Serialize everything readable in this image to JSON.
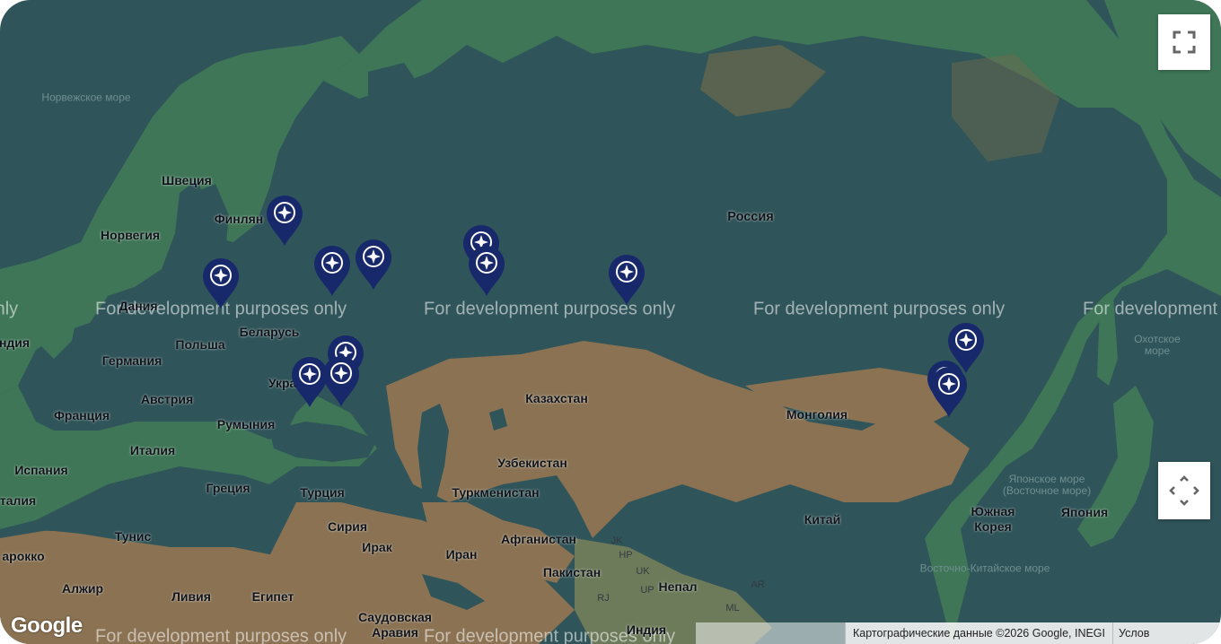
{
  "map": {
    "watermark_text": "For development purposes only",
    "google_logo": "Google",
    "attribution": "Картографические данные ©2026 Google, INEGI",
    "terms_link": "Услов",
    "colors": {
      "water": "#2f5459",
      "forest": "#3f7657",
      "desert": "#8a7253",
      "marker": "#17286b"
    }
  },
  "labels": {
    "norwegian_sea": "Норвежское море",
    "sweden": "Швеция",
    "finland": "Финлян",
    "norway": "Норвегия",
    "russia": "Россия",
    "denmark": "Дания",
    "poland": "Польша",
    "belarus": "Беларусь",
    "germany": "Германия",
    "austria": "Австрия",
    "france": "Франция",
    "ukraine": "Украина",
    "romania": "Румыния",
    "italy": "Италия",
    "spain": "Испания",
    "greece": "Греция",
    "turkey": "Турция",
    "kazakhstan": "Казахстан",
    "mongolia": "Монголия",
    "uzbekistan": "Узбекистан",
    "turkmenistan": "Туркменистан",
    "china": "Китай",
    "syria": "Сирия",
    "iraq": "Ирак",
    "iran": "Иран",
    "afghanistan": "Афганистан",
    "pakistan": "Пакистан",
    "nepal": "Непал",
    "india": "Индия",
    "saudi": "Саудовская Аравия",
    "egypt": "Египет",
    "libya": "Ливия",
    "algeria": "Алжир",
    "tunisia": "Тунис",
    "morocco": "арокко",
    "italy_edge": "талия",
    "ireland_edge": "ндия",
    "okhotsk_sea": "Охотское море",
    "japan_sea": "Японское море (Восточное море)",
    "japan": "Япония",
    "south_korea": "Южная Корея",
    "east_china_sea": "Восточно-Китайское море",
    "jk": "JK",
    "hp": "HP",
    "uk": "UK",
    "rj": "RJ",
    "up": "UP",
    "ar": "AR",
    "ml": "ML"
  },
  "markers": [
    {
      "name": "marker-saint-petersburg",
      "lon": 30.3,
      "lat": 59.9
    },
    {
      "name": "marker-kaliningrad",
      "lon": 20.5,
      "lat": 54.7
    },
    {
      "name": "marker-moscow",
      "lon": 37.6,
      "lat": 55.8
    },
    {
      "name": "marker-nizhny-novgorod",
      "lon": 44.0,
      "lat": 56.3
    },
    {
      "name": "marker-yekaterinburg-north",
      "lon": 60.6,
      "lat": 57.5
    },
    {
      "name": "marker-yekaterinburg",
      "lon": 61.4,
      "lat": 55.8
    },
    {
      "name": "marker-novosibirsk",
      "lon": 82.9,
      "lat": 55.0
    },
    {
      "name": "marker-crimea",
      "lon": 34.1,
      "lat": 44.9
    },
    {
      "name": "marker-rostov",
      "lon": 39.7,
      "lat": 47.2
    },
    {
      "name": "marker-krasnodar",
      "lon": 39.0,
      "lat": 45.0
    },
    {
      "name": "marker-khabarovsk",
      "lon": 135.1,
      "lat": 48.5
    },
    {
      "name": "marker-vladivostok-north",
      "lon": 132.0,
      "lat": 44.5
    },
    {
      "name": "marker-vladivostok",
      "lon": 132.5,
      "lat": 43.8
    }
  ]
}
